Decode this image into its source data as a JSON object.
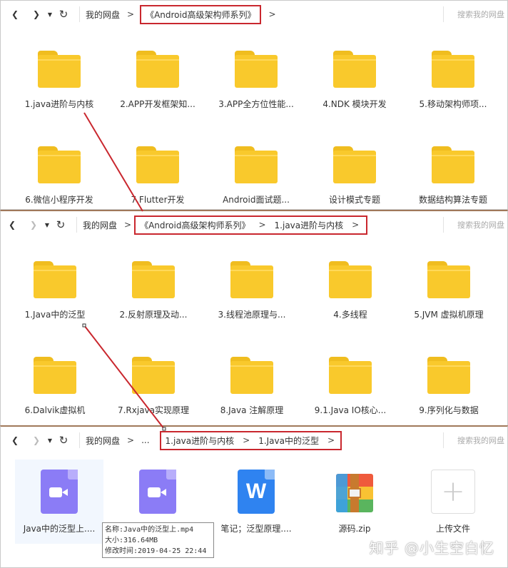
{
  "colors": {
    "highlight": "#c9272e",
    "folder": "#f9c92c",
    "video": "#8b7cf6",
    "word": "#2f83f0"
  },
  "panel1": {
    "breadcrumb": {
      "root": "我的网盘",
      "current": "《Android高级架构师系列》"
    },
    "search_placeholder": "搜索我的网盘",
    "folders": [
      "1.java进阶与内核",
      "2.APP开发框架知...",
      "3.APP全方位性能...",
      "4.NDK 模块开发",
      "5.移动架构师项...",
      "6.微信小程序开发",
      "7.Flutter开发",
      "Android面试题...",
      "设计模式专题",
      "数据结构算法专题"
    ]
  },
  "panel2": {
    "breadcrumb": {
      "root": "我的网盘",
      "parent": "《Android高级架构师系列》",
      "current": "1.java进阶与内核"
    },
    "search_placeholder": "搜索我的网盘",
    "folders": [
      "1.Java中的泛型",
      "2.反射原理及动...",
      "3.线程池原理与...",
      "4.多线程",
      "5.JVM 虚拟机原理",
      "6.Dalvik虚拟机",
      "7.Rxjava实现原理",
      "8.Java 注解原理",
      "9.1.Java IO核心...",
      "9.序列化与数据"
    ]
  },
  "panel3": {
    "breadcrumb": {
      "root": "我的网盘",
      "ellipsis": "...",
      "parent": "1.java进阶与内核",
      "current": "1.Java中的泛型"
    },
    "search_placeholder": "搜索我的网盘",
    "files": [
      {
        "name": "Java中的泛型上....",
        "icon": "video-file-icon"
      },
      {
        "name": "",
        "icon": "video-file-icon"
      },
      {
        "name": "笔记；泛型原理....",
        "icon": "word-file-icon"
      },
      {
        "name": "源码.zip",
        "icon": "zip-file-icon"
      },
      {
        "name": "上传文件",
        "icon": "upload-icon"
      }
    ],
    "tooltip": {
      "name": "名称:Java中的泛型上.mp4",
      "size": "大小:316.64MB",
      "mtime": "修改时间:2019-04-25 22:44"
    }
  },
  "watermark": "知乎 @小生空白忆"
}
